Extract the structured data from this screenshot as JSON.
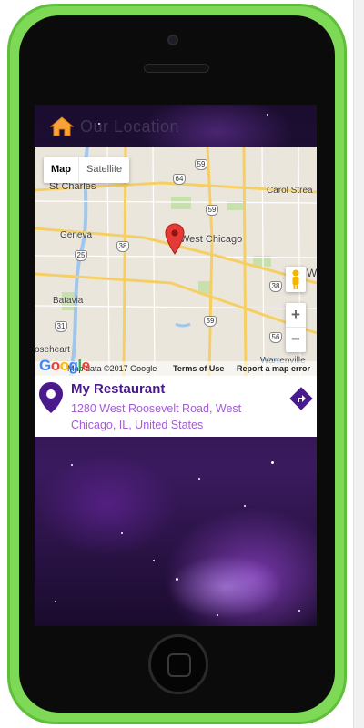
{
  "header": {
    "title": "Our Location"
  },
  "map": {
    "type_controls": {
      "map": "Map",
      "satellite": "Satellite",
      "selected": "Map"
    },
    "labels": {
      "st_charles": "St Charles",
      "west_chicago": "West Chicago",
      "carol_stream": "Carol Strea",
      "geneva": "Geneva",
      "batavia": "Batavia",
      "aurora_west": "oseheart",
      "warrenville": "Warrenville",
      "w_edge": "W"
    },
    "route_shields": [
      "64",
      "59",
      "59",
      "38",
      "25",
      "38",
      "31",
      "59",
      "56"
    ],
    "zoom_in": "+",
    "zoom_out": "−",
    "footer": {
      "google": "Google",
      "map_data": "Map data ©2017 Google",
      "terms": "Terms of Use",
      "report": "Report a map error"
    }
  },
  "place": {
    "name": "My Restaurant",
    "address": "1280 West Roosevelt Road, West Chicago, IL, United States"
  },
  "colors": {
    "accent": "#4a1a8c",
    "address": "#a35bd6",
    "phone_body": "#7ed957",
    "marker": "#e53935"
  },
  "icons": {
    "home": "home-icon",
    "place": "place-pin-icon",
    "directions": "directions-icon",
    "pegman": "pegman-icon"
  }
}
